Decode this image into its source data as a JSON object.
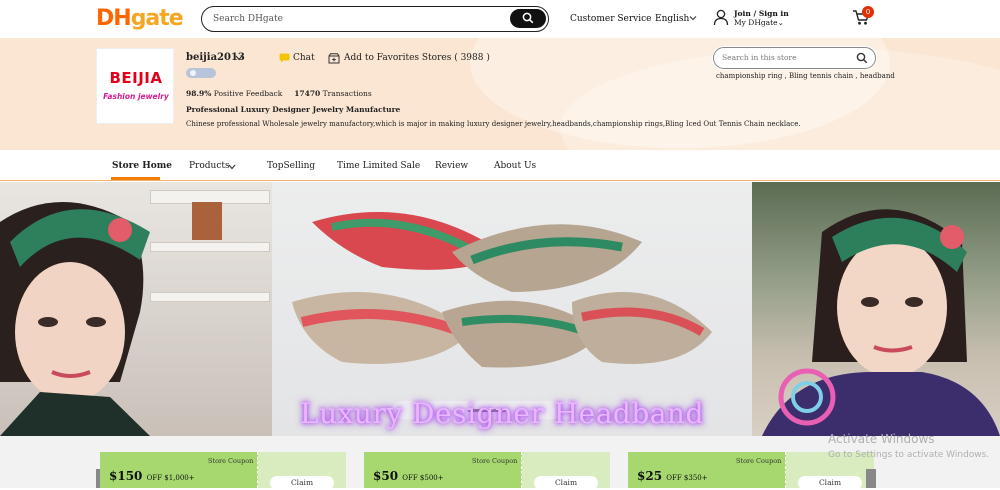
{
  "header": {
    "logo_dh": "DH",
    "logo_gate": "gate",
    "search_placeholder": "Search DHgate",
    "customer_service": "Customer Service",
    "language": "English",
    "join_signin": "Join / Sign in",
    "my_dhgate": "My DHgate",
    "cart_count": "0"
  },
  "store": {
    "logo_brand": "BEIJIA",
    "logo_sub": "Fashion jewelry",
    "name": "beijia2013",
    "chat": "Chat",
    "add_favorites": "Add to Favorites Stores ( 3988 )",
    "positive_feedback_value": "98.9%",
    "positive_feedback_label": "Positive Feedback",
    "transactions_value": "17470",
    "transactions_label": "Transactions",
    "headline": "Professional Luxury Designer Jewelry Manufacture",
    "description": "Chinese professional Wholesale jewelry manufactory,which is major in making luxury designer jewelry,headbands,championship rings,Bling Iced Out Tennis Chain necklace.",
    "search_placeholder": "Search in this store",
    "hot_words": "championship ring , Bling tennis chain , headband"
  },
  "nav": {
    "items": [
      {
        "label": "Store Home",
        "active": true
      },
      {
        "label": "Products"
      },
      {
        "label": "TopSelling"
      },
      {
        "label": "Time Limited Sale"
      },
      {
        "label": "Review"
      },
      {
        "label": "About Us"
      }
    ]
  },
  "hero": {
    "title": "Luxury Designer Headband"
  },
  "coupons": [
    {
      "label": "Store Coupon",
      "amount": "$150",
      "condition": "OFF $1,000+",
      "claim": "Claim"
    },
    {
      "label": "Store Coupon",
      "amount": "$50",
      "condition": "OFF $500+",
      "claim": "Claim"
    },
    {
      "label": "Store Coupon",
      "amount": "$25",
      "condition": "OFF $350+",
      "claim": "Claim"
    }
  ],
  "watermark": {
    "line1": "Activate Windows",
    "line2": "Go to Settings to activate Windows."
  },
  "colors": {
    "accent": "#f08000",
    "banner_bg": "#fbe6d3",
    "coupon_green": "#a6d86f",
    "cart_badge": "#e62e04"
  }
}
